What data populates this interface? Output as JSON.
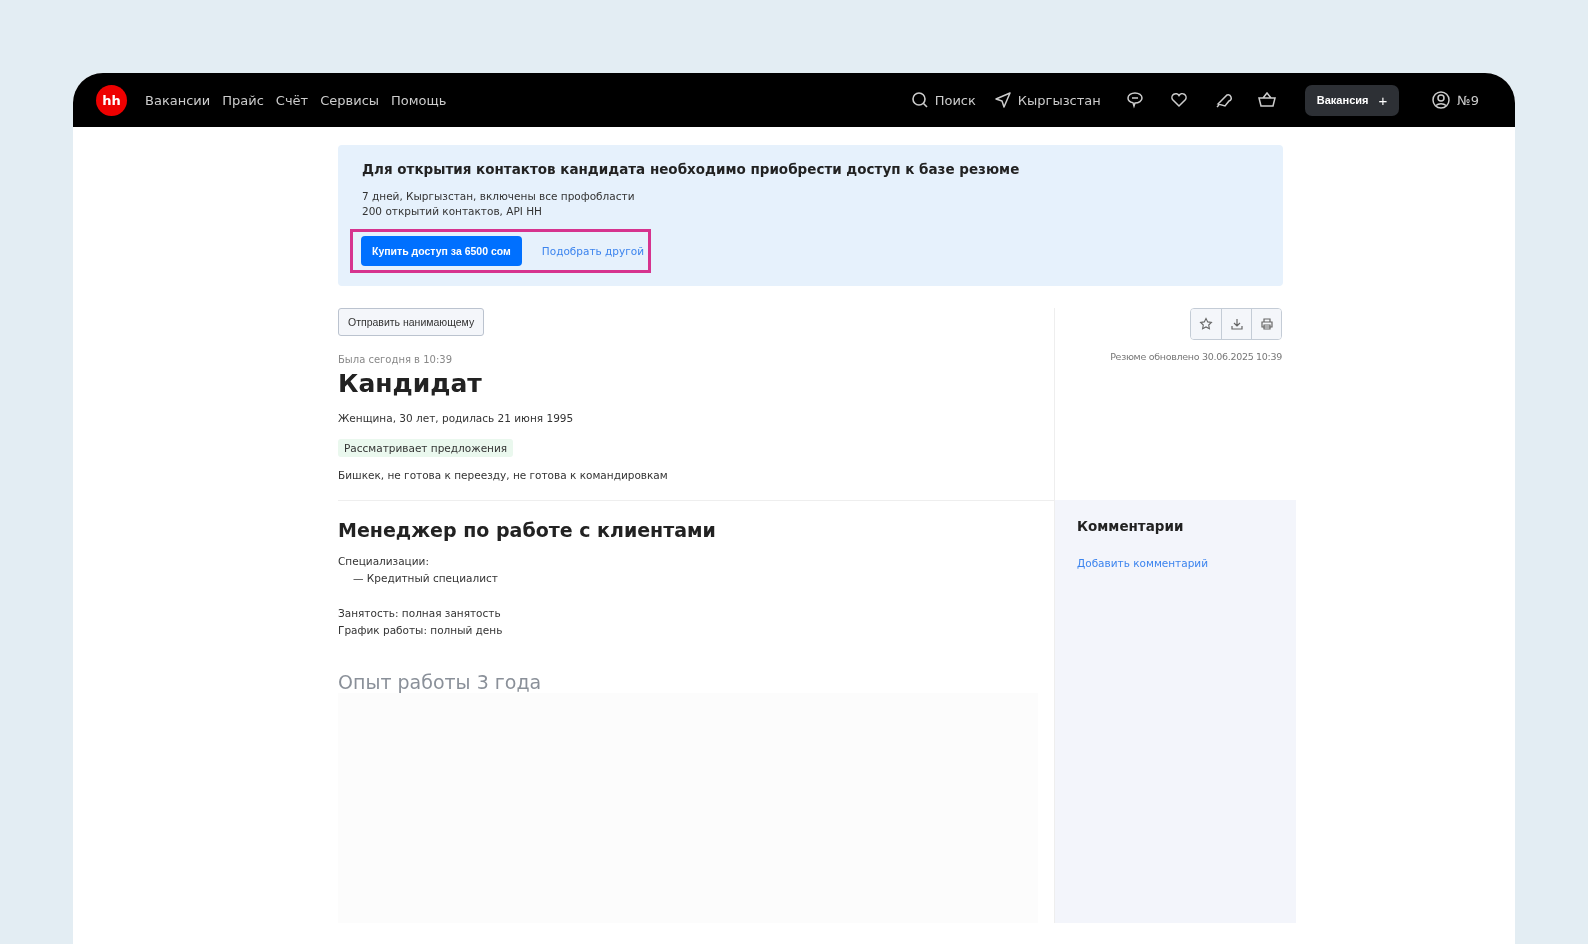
{
  "header": {
    "logo": "hh",
    "nav": [
      "Вакансии",
      "Прайс",
      "Счёт",
      "Сервисы",
      "Помощь"
    ],
    "search": "Поиск",
    "region": "Кыргызстан",
    "vacancy_button": "Вакансия",
    "vacancy_plus": "+",
    "account": "№9"
  },
  "banner": {
    "title": "Для открытия контактов кандидата необходимо приобрести доступ к базе резюме",
    "lines": [
      "7 дней, Кыргызстан, включены все профобласти",
      "200 открытий контактов, API HH"
    ],
    "buy_button": "Купить доступ за 6500 сом",
    "other_link": "Подобрать другой",
    "highlighted": true
  },
  "resume": {
    "send_button": "Отправить нанимающему",
    "last_seen": "Была сегодня в 10:39",
    "name": "Кандидат",
    "info": "Женщина, 30 лет, родилась 21 июня 1995",
    "status": "Рассматривает предложения",
    "location": "Бишкек, не готова к переезду, не готова к командировкам",
    "updated": "Резюме обновлено 30.06.2025 10:39",
    "position": "Менеджер по работе с клиентами",
    "spec_label": "Специализации:",
    "specs": [
      "— Кредитный специалист"
    ],
    "conditions": [
      "Занятость: полная занятость",
      "График работы: полный день"
    ],
    "experience": "Опыт работы 3 года"
  },
  "comments": {
    "title": "Комментарии",
    "add_link": "Добавить комментарий"
  }
}
